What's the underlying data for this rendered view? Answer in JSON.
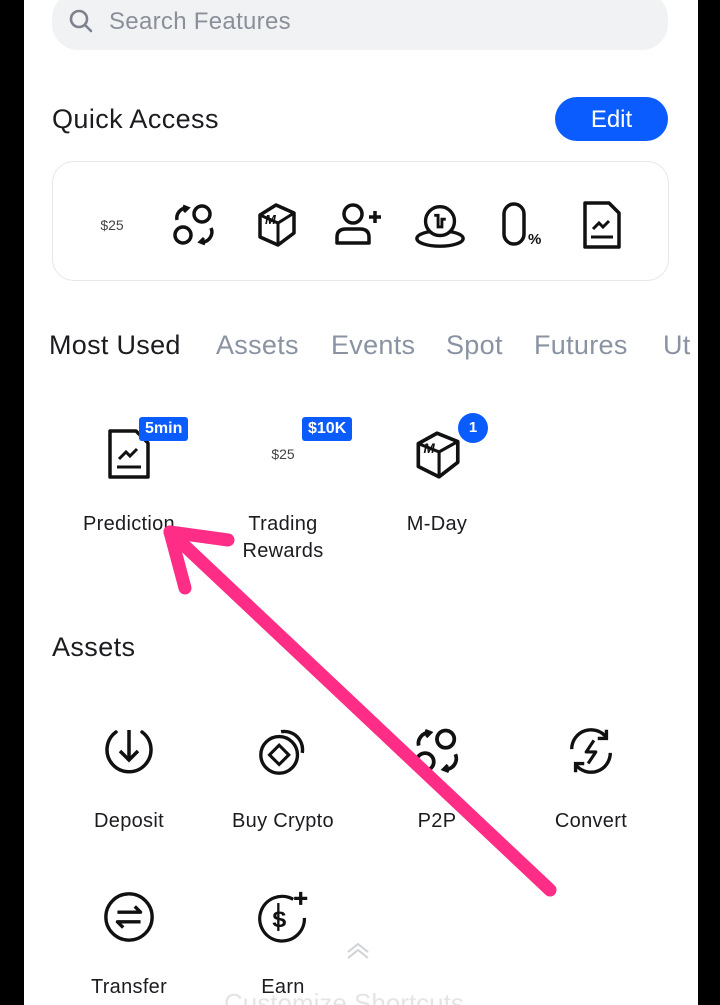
{
  "search": {
    "placeholder": "Search Features"
  },
  "quick_access": {
    "title": "Quick Access",
    "edit_label": "Edit",
    "items": [
      {
        "icon": "trading-rewards-icon",
        "text": "$25"
      },
      {
        "icon": "p2p-icon"
      },
      {
        "icon": "m-day-icon"
      },
      {
        "icon": "add-user-icon"
      },
      {
        "icon": "launchpool-icon"
      },
      {
        "icon": "zero-fee-icon"
      },
      {
        "icon": "prediction-icon"
      }
    ]
  },
  "tabs": [
    "Most Used",
    "Assets",
    "Events",
    "Spot",
    "Futures",
    "Ut"
  ],
  "most_used": [
    {
      "label": "Prediction",
      "badge": "5min",
      "icon": "prediction-icon"
    },
    {
      "label": "Trading\nRewards",
      "badge": "$10K",
      "icon_text": "$25",
      "icon": "trading-rewards-icon"
    },
    {
      "label": "M-Day",
      "badge": "1",
      "icon": "m-day-icon"
    }
  ],
  "assets": {
    "title": "Assets",
    "items": [
      {
        "label": "Deposit",
        "icon": "deposit-icon"
      },
      {
        "label": "Buy Crypto",
        "icon": "buy-crypto-icon"
      },
      {
        "label": "P2P",
        "icon": "p2p-icon"
      },
      {
        "label": "Convert",
        "icon": "convert-icon"
      },
      {
        "label": "Transfer",
        "icon": "transfer-icon"
      },
      {
        "label": "Earn",
        "icon": "earn-icon"
      }
    ]
  },
  "bottom_hint": "Customize Shortcuts",
  "colors": {
    "accent": "#0b5cff",
    "annotation_arrow": "#ff2d86"
  }
}
